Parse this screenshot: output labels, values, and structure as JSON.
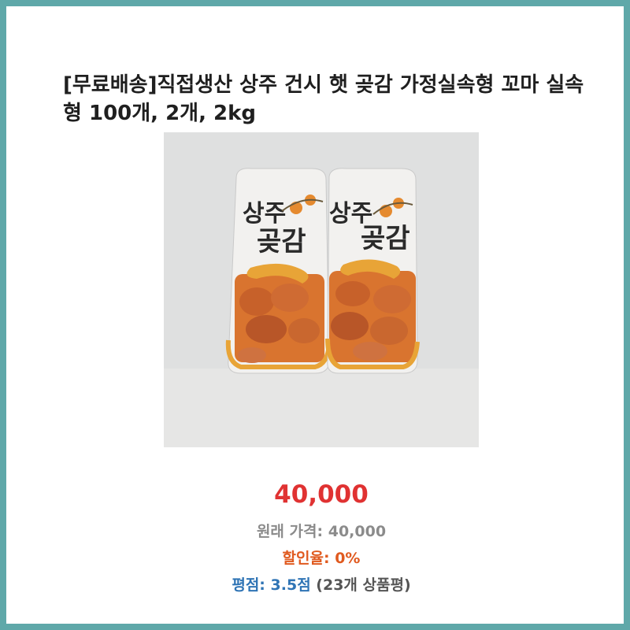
{
  "product": {
    "title": "[무료배송]직접생산 상주 건시 햇 곶감 가정실속형 꼬마 실속형 100개, 2개, 2kg",
    "package_text_line1": "상주",
    "package_text_line2": "곶감"
  },
  "pricing": {
    "price": "40,000",
    "original_price_label": "원래 가격:",
    "original_price": "40,000",
    "discount_label": "할인율:",
    "discount_rate": "0%"
  },
  "rating": {
    "label": "평점:",
    "score": "3.5점",
    "review_count": "(23개 상품평)"
  },
  "colors": {
    "frame": "#5fa8a9",
    "price": "#e03232",
    "discount": "#e05a1f",
    "rating": "#2f74b5"
  }
}
